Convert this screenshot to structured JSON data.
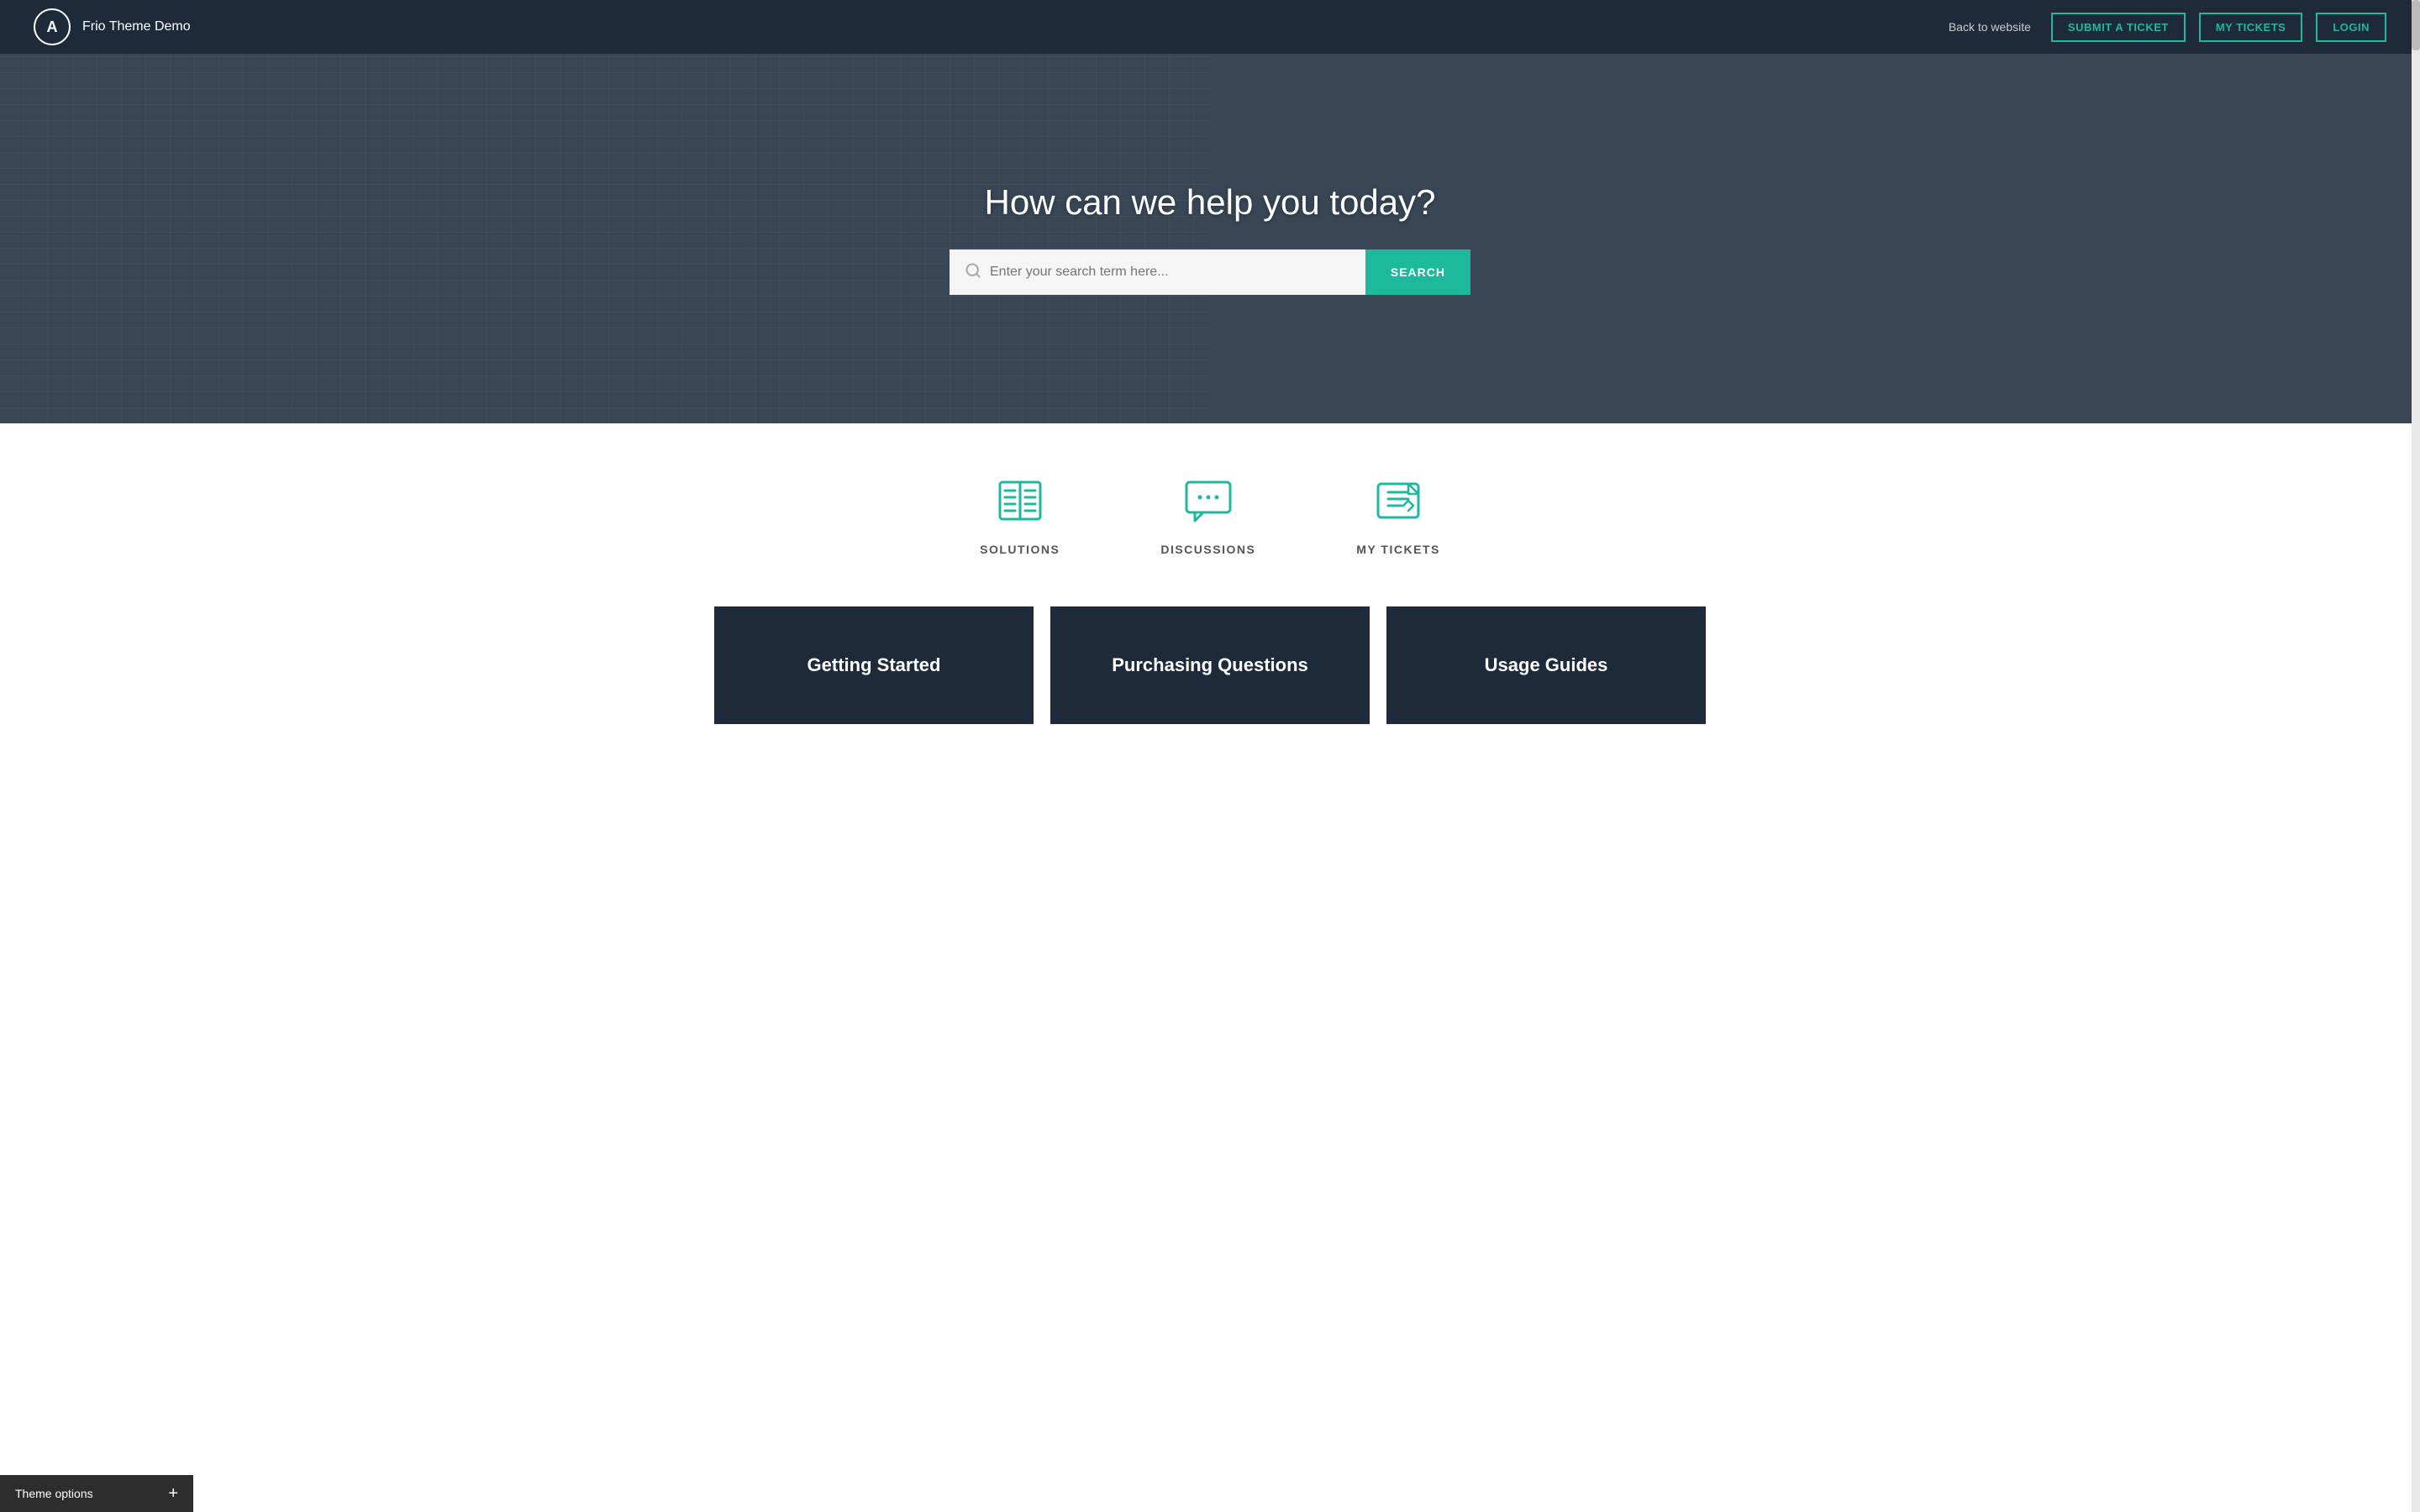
{
  "navbar": {
    "logo_letter": "A",
    "site_title": "Frio Theme Demo",
    "back_link_label": "Back to website",
    "submit_ticket_label": "SUBMIT A TICKET",
    "my_tickets_label": "MY TICKETS",
    "login_label": "LOGIN"
  },
  "hero": {
    "title": "How can we help you today?",
    "search_placeholder": "Enter your search term here...",
    "search_button_label": "SEARCH"
  },
  "icons_section": {
    "items": [
      {
        "id": "solutions",
        "label": "SOLUTIONS"
      },
      {
        "id": "discussions",
        "label": "DISCUSSIONS"
      },
      {
        "id": "my-tickets",
        "label": "MY TICKETS"
      }
    ]
  },
  "cards_section": {
    "cards": [
      {
        "id": "getting-started",
        "label": "Getting Started"
      },
      {
        "id": "purchasing-questions",
        "label": "Purchasing Questions"
      },
      {
        "id": "usage-guides",
        "label": "Usage Guides"
      }
    ]
  },
  "theme_options": {
    "label": "Theme options",
    "plus_symbol": "+"
  }
}
